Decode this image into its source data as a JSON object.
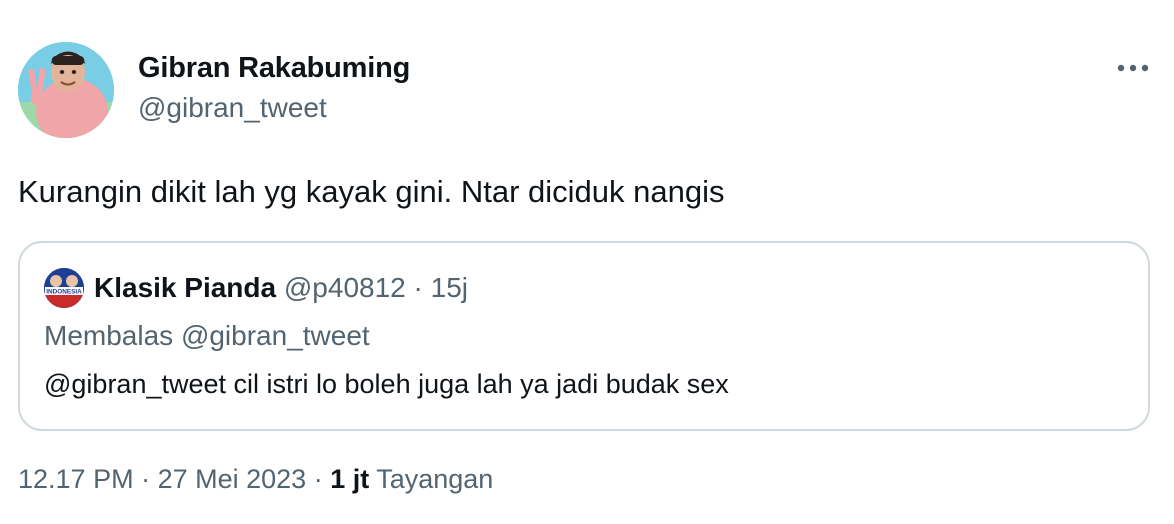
{
  "author": {
    "name": "Gibran Rakabuming",
    "handle": "@gibran_tweet"
  },
  "tweet": {
    "text": "Kurangin dikit lah yg kayak gini. Ntar diciduk nangis"
  },
  "quote": {
    "author_name": "Klasik Pianda",
    "author_handle": "@p40812",
    "separator": " · ",
    "time": "15j",
    "reply_to": "Membalas @gibran_tweet",
    "text": "@gibran_tweet cil istri lo boleh juga lah ya jadi budak sex",
    "avatar_logo_text": "INDONESIA"
  },
  "meta": {
    "time": "12.17 PM",
    "separator": " · ",
    "date": "27 Mei 2023",
    "views_count": "1 jt",
    "views_label": "Tayangan"
  },
  "colors": {
    "text_primary": "#0f1419",
    "text_secondary": "#536471",
    "border": "#cfd9de"
  },
  "icons": {
    "more": "more-horizontal-icon"
  }
}
